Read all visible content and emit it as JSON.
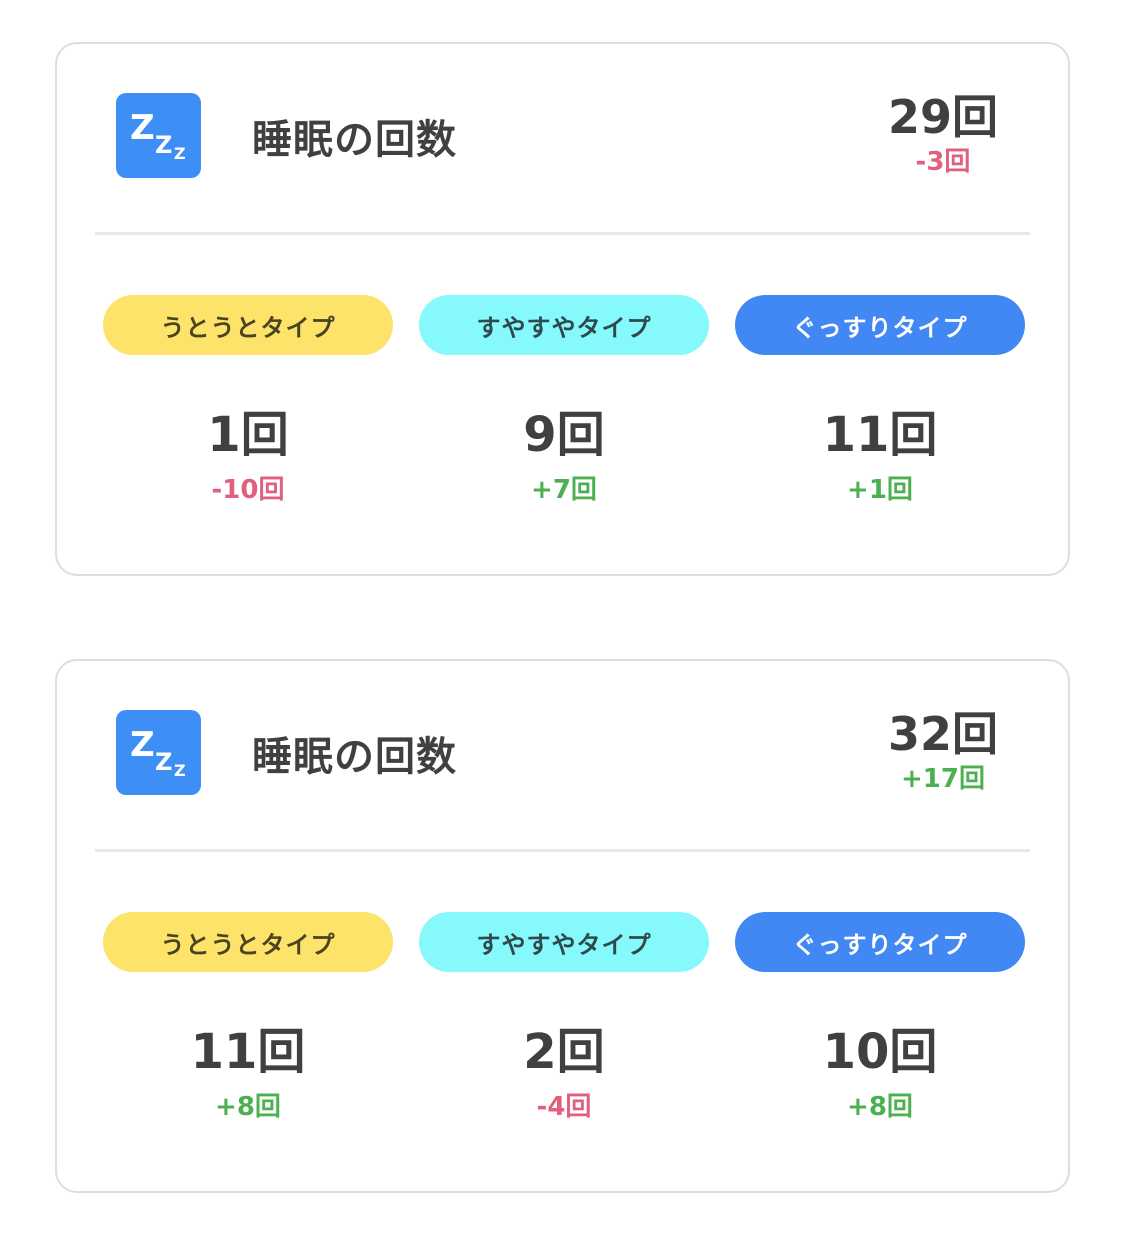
{
  "colors": {
    "icon_bg": "#3d8ef5",
    "negative": "#e0607e",
    "positive": "#4caf50",
    "light_type": "#fde36a",
    "deep_type": "#85f9fc",
    "sound_type": "#4188f4"
  },
  "cards": [
    {
      "icon": "sleep-zzz-icon",
      "title": "睡眠の回数",
      "total": "29回",
      "total_change": "-3回",
      "total_change_sign": "neg",
      "types": [
        {
          "label": "うとうとタイプ",
          "count": "1回",
          "change": "-10回",
          "sign": "neg"
        },
        {
          "label": "すやすやタイプ",
          "count": "9回",
          "change": "+7回",
          "sign": "pos"
        },
        {
          "label": "ぐっすりタイプ",
          "count": "11回",
          "change": "+1回",
          "sign": "pos"
        }
      ]
    },
    {
      "icon": "sleep-zzz-icon",
      "title": "睡眠の回数",
      "total": "32回",
      "total_change": "+17回",
      "total_change_sign": "pos",
      "types": [
        {
          "label": "うとうとタイプ",
          "count": "11回",
          "change": "+8回",
          "sign": "pos"
        },
        {
          "label": "すやすやタイプ",
          "count": "2回",
          "change": "-4回",
          "sign": "neg"
        },
        {
          "label": "ぐっすりタイプ",
          "count": "10回",
          "change": "+8回",
          "sign": "pos"
        }
      ]
    }
  ]
}
